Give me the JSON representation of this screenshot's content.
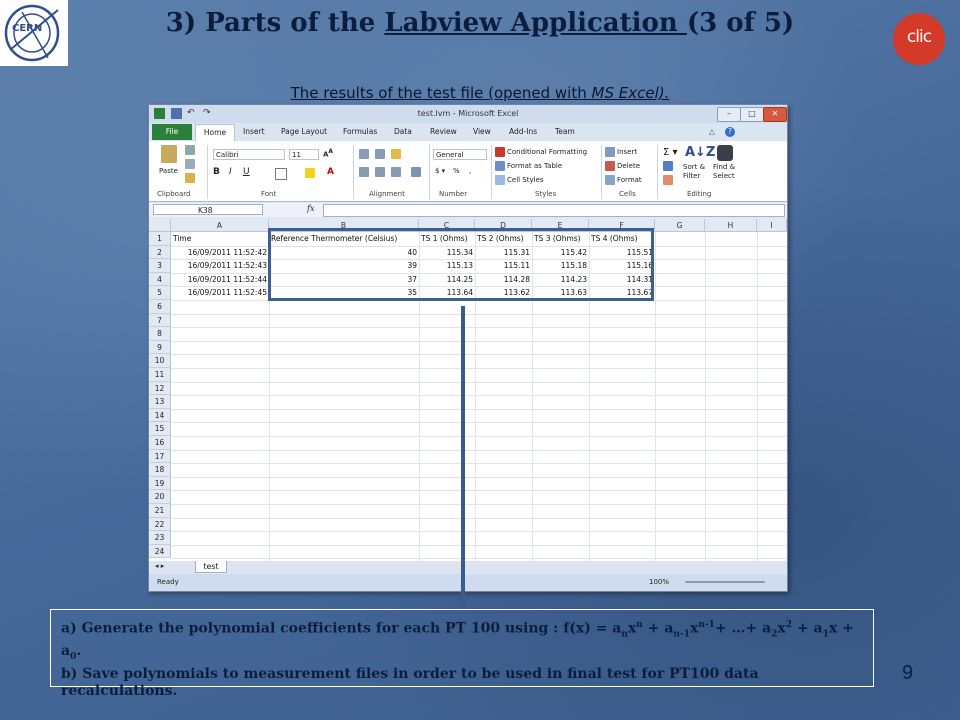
{
  "slide": {
    "title_prefix": "3) Parts of the ",
    "title_underlined": "Labview Application ",
    "title_suffix": "(3 of 5)",
    "subtitle_prefix": "The results of the test file (opened with ",
    "subtitle_italic": "MS Excel).",
    "clic_logo_text": "clic",
    "page_number": "9",
    "colors": {
      "title": "#0b1d3d",
      "accent_red": "#d43a2a",
      "highlight": "#3c5f96"
    }
  },
  "note": {
    "line_a_prefix": "a) Generate the polynomial coefficients for each PT 100 using : f(x) = a",
    "line_b": "b) Save polynomials to measurement files  in order to be used in final test for PT100 data recalculations."
  },
  "excel": {
    "window_title": "test.lvm  -  Microsoft Excel",
    "tabs": {
      "file": "File",
      "home": "Home",
      "insert": "Insert",
      "page_layout": "Page Layout",
      "formulas": "Formulas",
      "data": "Data",
      "review": "Review",
      "view": "View",
      "addins": "Add-Ins",
      "team": "Team"
    },
    "ribbon": {
      "paste": "Paste",
      "font_name": "Calibri",
      "font_size": "11",
      "number_format": "General",
      "conditional_formatting": "Conditional Formatting",
      "format_as_table": "Format as Table",
      "cell_styles": "Cell Styles",
      "insert": "Insert",
      "delete": "Delete",
      "format": "Format",
      "sort_filter_1": "Sort &",
      "sort_filter_2": "Filter",
      "find_select_1": "Find &",
      "find_select_2": "Select",
      "groups": {
        "clipboard": "Clipboard",
        "font": "Font",
        "alignment": "Alignment",
        "number": "Number",
        "styles": "Styles",
        "cells": "Cells",
        "editing": "Editing"
      }
    },
    "name_box": "K38",
    "fx_label": "fx",
    "columns": [
      "A",
      "B",
      "C",
      "D",
      "E",
      "F",
      "G",
      "H",
      "I"
    ],
    "rows": [
      "1",
      "2",
      "3",
      "4",
      "5",
      "6",
      "7",
      "8",
      "9",
      "10",
      "11",
      "12",
      "13",
      "14",
      "15",
      "16",
      "17",
      "18",
      "19",
      "20",
      "21",
      "22",
      "23",
      "24"
    ],
    "headers": [
      "Time",
      "Reference Thermometer (Celsius)",
      "TS 1 (Ohms)",
      "TS 2 (Ohms)",
      "TS 3 (Ohms)",
      "TS 4 (Ohms)"
    ],
    "data_rows": [
      [
        "16/09/2011  11:52:42",
        "40",
        "115.34",
        "115.31",
        "115.42",
        "115.51"
      ],
      [
        "16/09/2011  11:52:43",
        "39",
        "115.13",
        "115.11",
        "115.18",
        "115.16"
      ],
      [
        "16/09/2011  11:52:44",
        "37",
        "114.25",
        "114.28",
        "114.23",
        "114.31"
      ],
      [
        "16/09/2011  11:52:45",
        "35",
        "113.64",
        "113.62",
        "113.63",
        "113.67"
      ]
    ],
    "sheet_tab": "test",
    "status": "Ready",
    "zoom": "100%"
  }
}
